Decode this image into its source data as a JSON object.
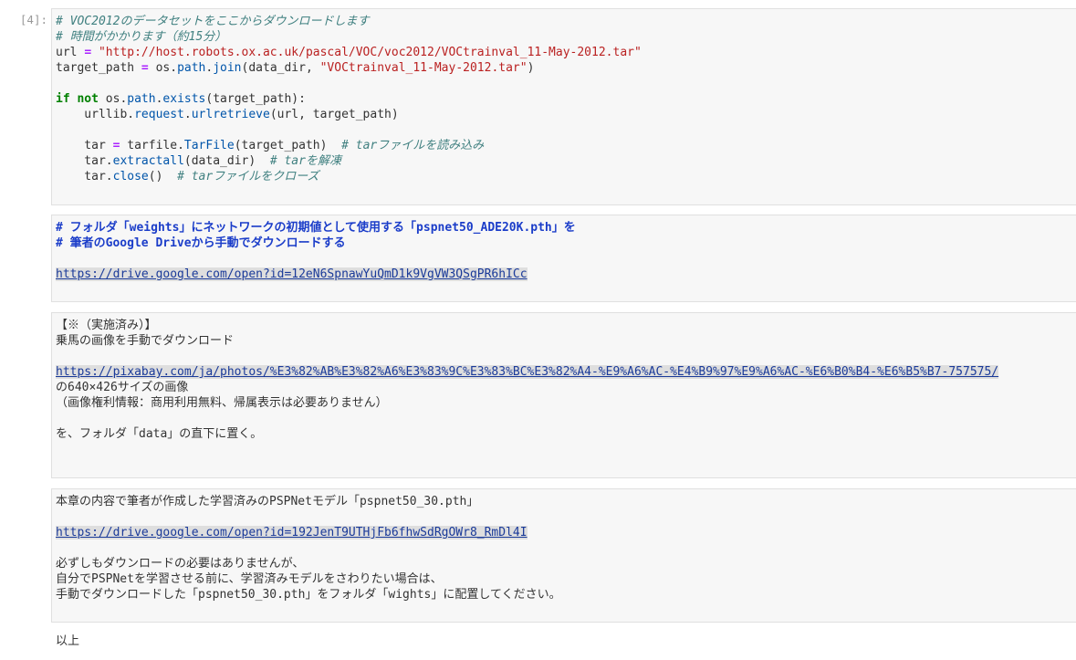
{
  "cell1": {
    "prompt": "[4]:",
    "comment1": "# VOC2012のデータセットをここからダウンロードします",
    "comment2": "# 時間がかかります（約15分）",
    "url_var": "url",
    "eq": "=",
    "url_value": "\"http://host.robots.ox.ac.uk/pascal/VOC/voc2012/VOCtrainval_11-May-2012.tar\"",
    "target_var": "target_path",
    "os": "os.",
    "path": "path",
    "dot": ".",
    "join": "join",
    "join_args_open": "(data_dir, ",
    "tar_name": "\"VOCtrainval_11-May-2012.tar\"",
    "close_paren": ")",
    "kw_if": "if",
    "kw_not": "not",
    "exists": "exists",
    "exists_args": "(target_path):",
    "indent_urllib": "    urllib.",
    "request": "request",
    "urlretrieve": "urlretrieve",
    "urlretrieve_args": "(url, target_path)",
    "indent_tar": "    tar ",
    "tarfile": "tarfile.",
    "TarFile": "TarFile",
    "tarfile_args": "(target_path)  ",
    "comment_read": "# tarファイルを読み込み",
    "indent_tar_dot": "    tar.",
    "extractall": "extractall",
    "extract_args": "(data_dir)  ",
    "comment_extract": "# tarを解凍",
    "close": "close",
    "close_args": "()  ",
    "comment_close": "# tarファイルをクローズ"
  },
  "cell2": {
    "heading1": "# フォルダ「weights」にネットワークの初期値として使用する「pspnet50_ADE20K.pth」を",
    "heading2": "# 筆者のGoogle Driveから手動でダウンロードする",
    "link": "https://drive.google.com/open?id=12eN6SpnawYuQmD1k9VgVW3QSgPR6hICc"
  },
  "cell3": {
    "line1": "【※（実施済み）】",
    "line2": "乗馬の画像を手動でダウンロード",
    "link": "https://pixabay.com/ja/photos/%E3%82%AB%E3%82%A6%E3%83%9C%E3%83%BC%E3%82%A4-%E9%A6%AC-%E4%B9%97%E9%A6%AC-%E6%B0%B4-%E6%B5%B7-757575/",
    "line3": "の640×426サイズの画像",
    "line4": "（画像権利情報：商用利用無料、帰属表示は必要ありません）",
    "line5": "を、フォルダ「data」の直下に置く。"
  },
  "cell4": {
    "line1": "本章の内容で筆者が作成した学習済みのPSPNetモデル「pspnet50_30.pth」",
    "link": "https://drive.google.com/open?id=192JenT9UTHjFb6fhwSdRgOWr8_RmDl4I",
    "line2": "必ずしもダウンロードの必要はありませんが、",
    "line3": "自分でPSPNetを学習させる前に、学習済みモデルをさわりたい場合は、",
    "line4": "手動でダウンロードした「pspnet50_30.pth」をフォルダ「wights」に配置してください。"
  },
  "footer": {
    "text": "以上"
  }
}
